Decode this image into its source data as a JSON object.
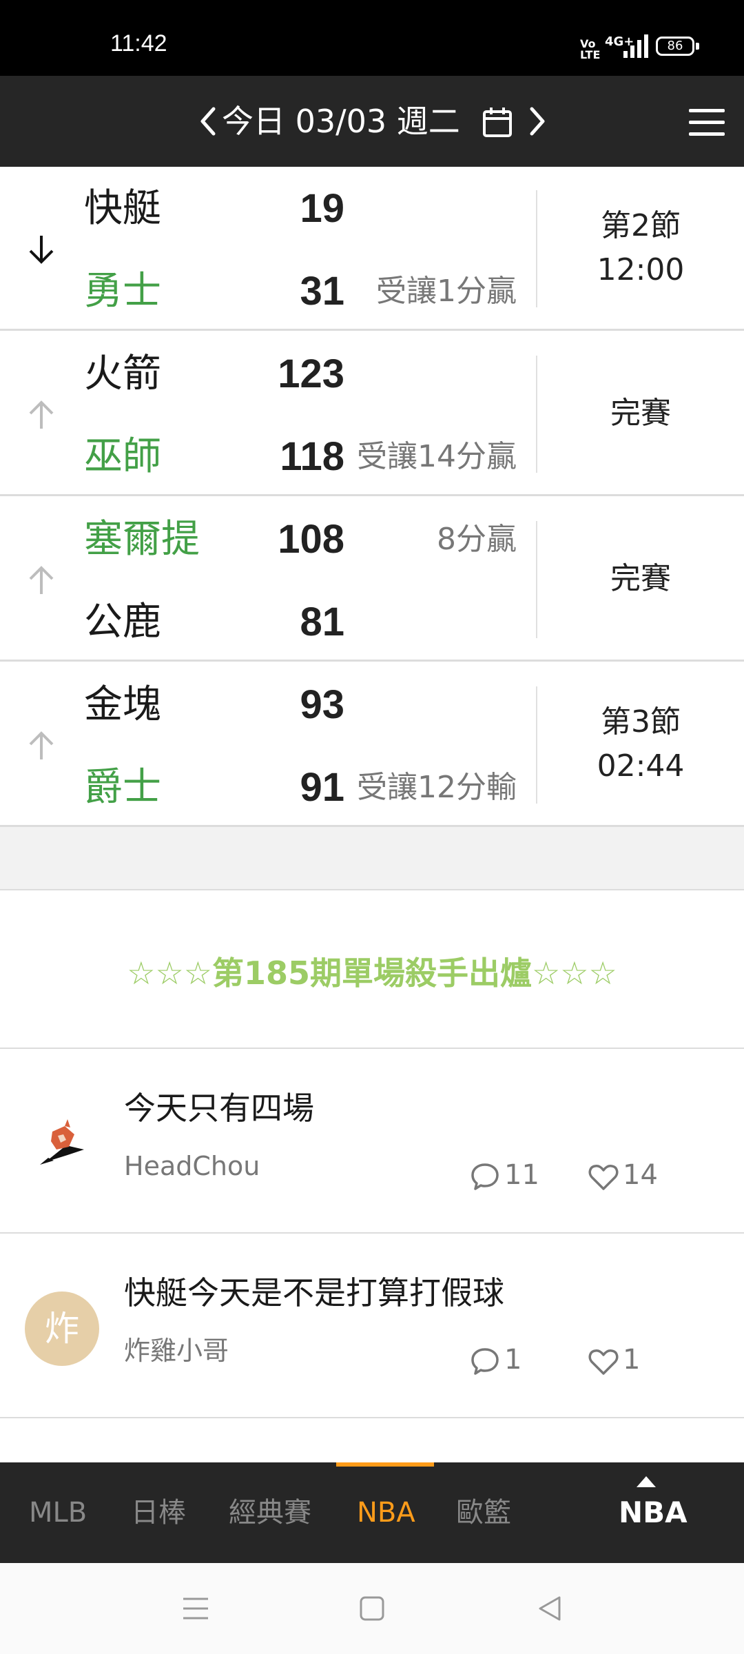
{
  "status_bar": {
    "time": "11:42",
    "volte": "Vo LTE",
    "network": "4G+",
    "battery": "86"
  },
  "date_header": {
    "date_label": "今日 03/03 週二",
    "prev_icon": "chevron-left-icon",
    "next_icon": "chevron-right-icon",
    "calendar_icon": "calendar-icon",
    "menu_icon": "hamburger-menu-icon"
  },
  "games": [
    {
      "trend_icon": "arrow-down-icon",
      "trend_color": "#111111",
      "team1": {
        "name": "快艇",
        "score": "19",
        "note": "",
        "winning": false
      },
      "team2": {
        "name": "勇士",
        "score": "31",
        "note": "受讓1分贏",
        "winning": true
      },
      "status_line1": "第2節",
      "status_line2": "12:00"
    },
    {
      "trend_icon": "arrow-up-icon",
      "trend_color": "#bdbdbd",
      "team1": {
        "name": "火箭",
        "score": "123",
        "note": "",
        "winning": false
      },
      "team2": {
        "name": "巫師",
        "score": "118",
        "note": "受讓14分贏",
        "winning": true
      },
      "status_line1": "完賽",
      "status_line2": ""
    },
    {
      "trend_icon": "arrow-up-icon",
      "trend_color": "#bdbdbd",
      "team1": {
        "name": "塞爾提",
        "score": "108",
        "note": "8分贏",
        "winning": true
      },
      "team2": {
        "name": "公鹿",
        "score": "81",
        "note": "",
        "winning": false
      },
      "status_line1": "完賽",
      "status_line2": ""
    },
    {
      "trend_icon": "arrow-up-icon",
      "trend_color": "#bdbdbd",
      "team1": {
        "name": "金塊",
        "score": "93",
        "note": "",
        "winning": false
      },
      "team2": {
        "name": "爵士",
        "score": "91",
        "note": "受讓12分輸",
        "winning": true
      },
      "status_line1": "第3節",
      "status_line2": "02:44"
    }
  ],
  "banner": {
    "text": "☆☆☆第185期單場殺手出爐☆☆☆",
    "color": "#9ccc65"
  },
  "posts": [
    {
      "title": "今天只有四場",
      "author": "HeadChou",
      "comments": "11",
      "likes": "14",
      "avatar_icon": "fox-avatar-icon"
    },
    {
      "title": "快艇今天是不是打算打假球",
      "author": "炸雞小哥",
      "comments": "1",
      "likes": "1",
      "avatar_letter": "炸",
      "avatar_color": "#e6cfa8"
    }
  ],
  "tabs": {
    "items": [
      "MLB",
      "日棒",
      "經典賽",
      "NBA",
      "歐籃"
    ],
    "active": "NBA",
    "current_league": "NBA",
    "accent": "#ff9c1a"
  },
  "nav": {
    "menu_icon": "recent-apps-icon",
    "home_icon": "home-icon",
    "back_icon": "back-icon"
  }
}
